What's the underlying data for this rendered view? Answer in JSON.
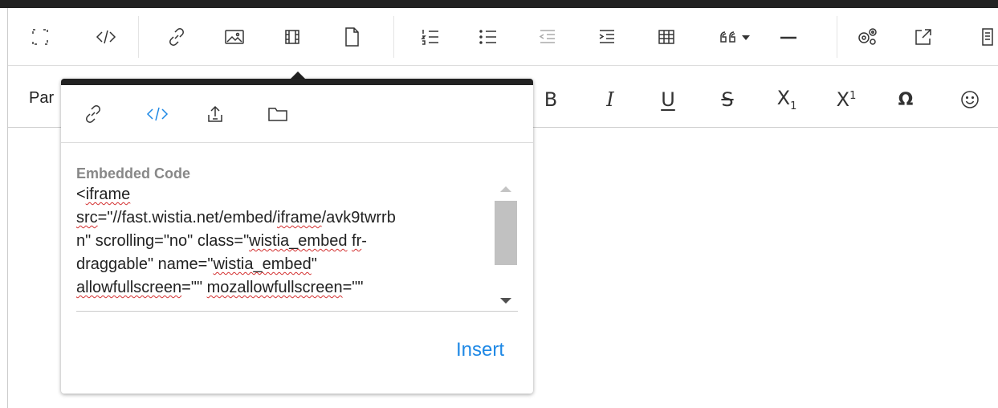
{
  "toolbar": {
    "paragraph_format": "Par",
    "row1_icons": [
      "fullscreen-icon",
      "code-view-icon",
      "link-icon",
      "image-icon",
      "video-icon",
      "file-icon",
      "ordered-list-icon",
      "unordered-list-icon",
      "outdent-icon",
      "indent-icon",
      "table-icon",
      "quote-icon",
      "horizontal-line-icon",
      "settings-icon",
      "external-link-icon",
      "clipboard-icon"
    ],
    "format_glyphs": {
      "bold": "B",
      "italic": "I",
      "underline": "U",
      "strike": "S",
      "subscript": "X",
      "subscript_index": "1",
      "superscript": "X",
      "superscript_index": "1",
      "special_char": "Ω",
      "emoji": "☺"
    }
  },
  "popup": {
    "tabs": [
      {
        "icon": "link-icon",
        "active": false
      },
      {
        "icon": "embed-code-icon",
        "active": true
      },
      {
        "icon": "upload-icon",
        "active": false
      },
      {
        "icon": "folder-icon",
        "active": false
      }
    ],
    "field_label": "Embedded Code",
    "code": {
      "l1a": "<",
      "l1b": "iframe",
      "l2a": "src",
      "l2b": "=\"//fast.wistia.net/embed/",
      "l2c": "iframe",
      "l2d": "/avk9twrrb",
      "l3a": "n\" scrolling=\"no\" class=\"",
      "l3b": "wistia_embed",
      "l3c": " ",
      "l3d": "fr",
      "l3e": "-",
      "l4a": "draggable\" name=\"",
      "l4b": "wistia_embed",
      "l4c": "\"",
      "l5a": "allowfullscreen",
      "l5b": "=\"\" ",
      "l5c": "mozallowfullscreen",
      "l5d": "=\"\""
    },
    "insert_label": "Insert",
    "accent_color": "#1e88e5"
  }
}
